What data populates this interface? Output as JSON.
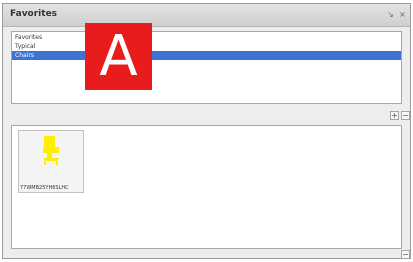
{
  "window": {
    "title": "Favorites",
    "pin_glyph": "↘",
    "close_glyph": "×"
  },
  "categories": [
    {
      "label": "Favorites",
      "selected": false
    },
    {
      "label": "Typical",
      "selected": false
    },
    {
      "label": "Chairs",
      "selected": true
    }
  ],
  "category_buttons": {
    "add_glyph": "+",
    "remove_glyph": "−"
  },
  "items": [
    {
      "label": "77WMB25YH6SLHC",
      "icon": "yellow-chair-icon"
    }
  ],
  "items_buttons": {
    "remove_glyph": "−"
  },
  "marker": {
    "label": "A"
  },
  "colors": {
    "selection": "#3d73d1",
    "marker": "#e81c1c",
    "chair": "#ffee00"
  }
}
